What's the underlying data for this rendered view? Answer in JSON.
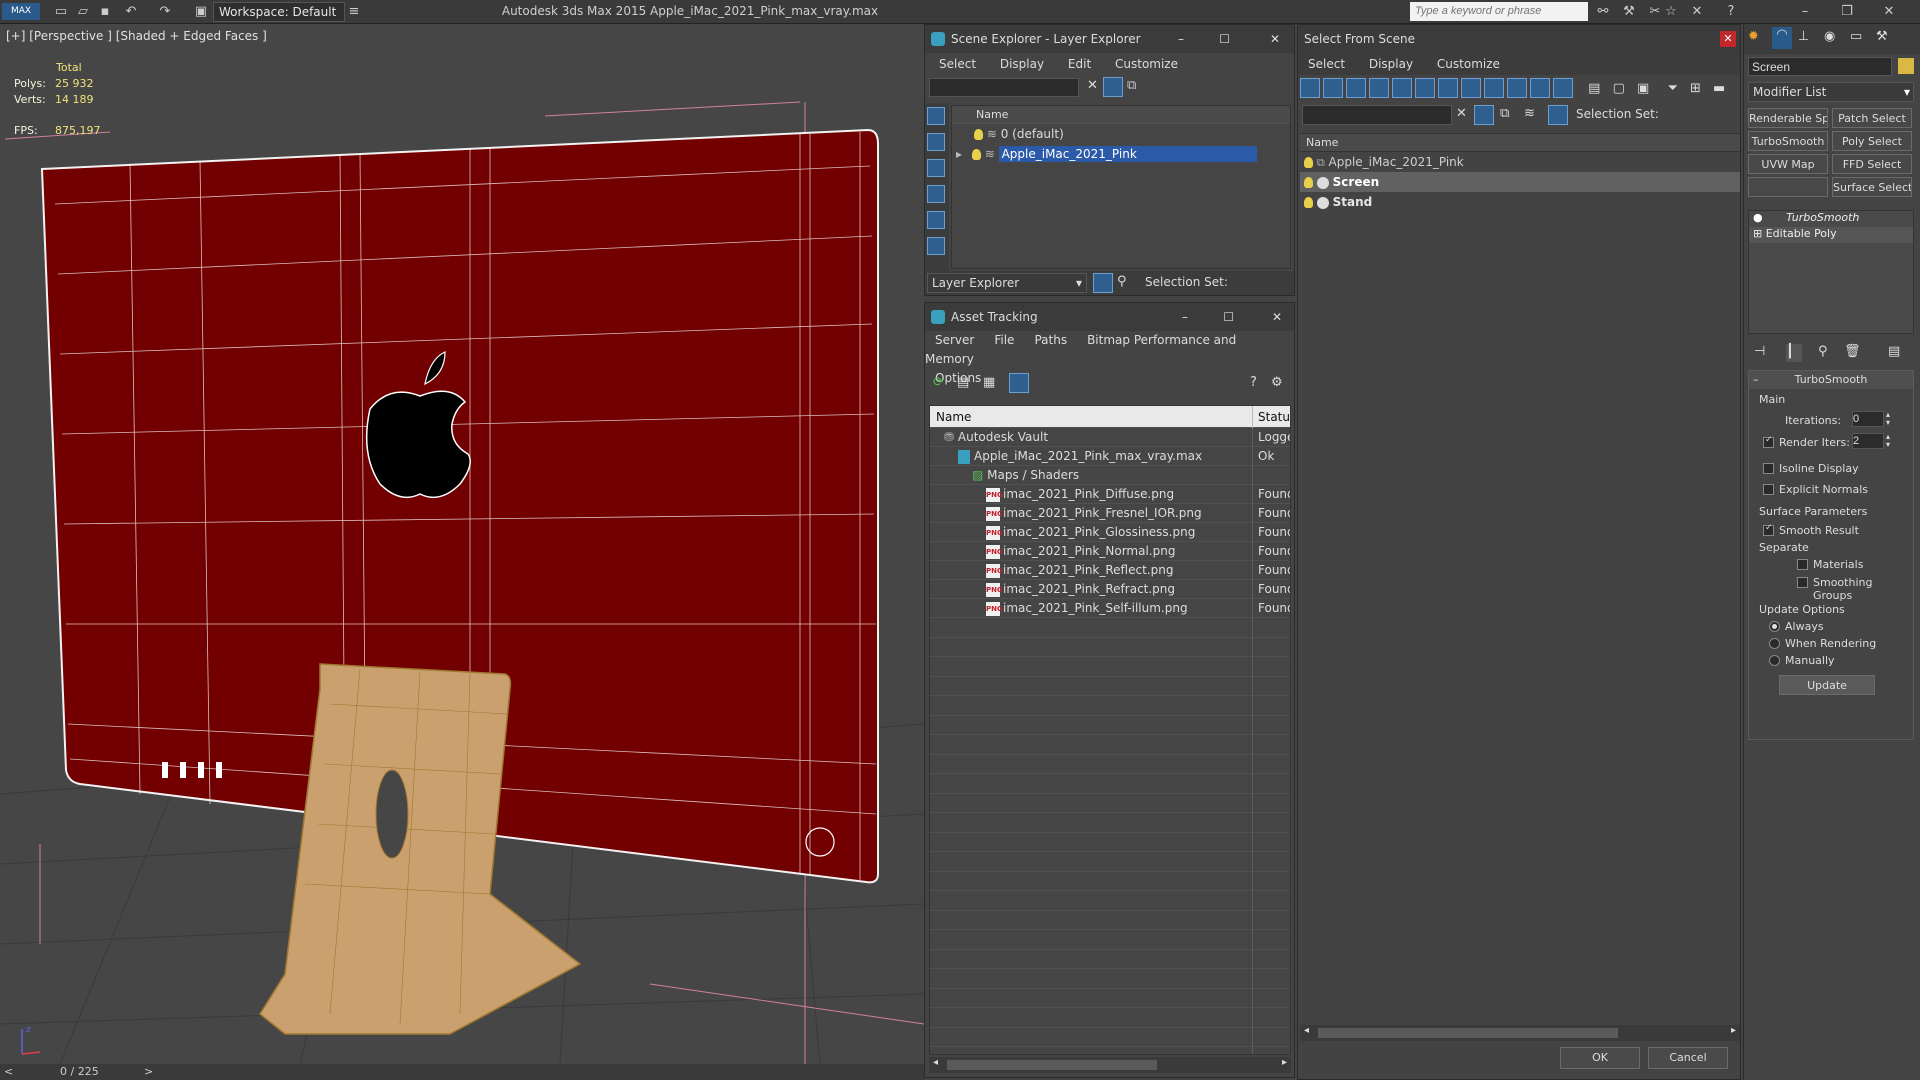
{
  "titlebar": {
    "app_title": "Autodesk 3ds Max  2015     Apple_iMac_2021_Pink_max_vray.max",
    "workspace": "Workspace: Default",
    "search_placeholder": "Type a keyword or phrase"
  },
  "viewport": {
    "label": "[+] [Perspective ] [Shaded + Edged Faces ]",
    "stats": {
      "total_label": "Total",
      "polys_label": "Polys:",
      "polys": "25 932",
      "verts_label": "Verts:",
      "verts": "14 189",
      "fps_label": "FPS:",
      "fps": "875,197"
    },
    "frame_counter": "0 / 225"
  },
  "scene_explorer": {
    "title": "Scene Explorer - Layer Explorer",
    "menu": [
      "Select",
      "Display",
      "Edit",
      "Customize"
    ],
    "column_name": "Name",
    "layers": [
      {
        "name": "0 (default)",
        "selected": false
      },
      {
        "name": "Apple_iMac_2021_Pink",
        "selected": true
      }
    ],
    "footer_dropdown": "Layer Explorer",
    "footer_selection_set": "Selection Set:"
  },
  "asset_tracking": {
    "title": "Asset Tracking",
    "menu": [
      "Server",
      "File",
      "Paths",
      "Bitmap Performance and Memory",
      "Options"
    ],
    "col_name": "Name",
    "col_status": "Status",
    "rows": [
      {
        "name": "Autodesk Vault",
        "status": "Logged",
        "indent": 1,
        "icon": "vault"
      },
      {
        "name": "Apple_iMac_2021_Pink_max_vray.max",
        "status": "Ok",
        "indent": 2,
        "icon": "max"
      },
      {
        "name": "Maps / Shaders",
        "status": "",
        "indent": 3,
        "icon": "maps"
      },
      {
        "name": "imac_2021_Pink_Diffuse.png",
        "status": "Found",
        "indent": 4,
        "icon": "png"
      },
      {
        "name": "imac_2021_Pink_Fresnel_IOR.png",
        "status": "Found",
        "indent": 4,
        "icon": "png"
      },
      {
        "name": "imac_2021_Pink_Glossiness.png",
        "status": "Found",
        "indent": 4,
        "icon": "png"
      },
      {
        "name": "imac_2021_Pink_Normal.png",
        "status": "Found",
        "indent": 4,
        "icon": "png"
      },
      {
        "name": "imac_2021_Pink_Reflect.png",
        "status": "Found",
        "indent": 4,
        "icon": "png"
      },
      {
        "name": "imac_2021_Pink_Refract.png",
        "status": "Found",
        "indent": 4,
        "icon": "png"
      },
      {
        "name": "imac_2021_Pink_Self-illum.png",
        "status": "Found",
        "indent": 4,
        "icon": "png"
      }
    ],
    "png_badge": "PNG"
  },
  "select_from_scene": {
    "title": "Select From Scene",
    "menu": [
      "Select",
      "Display",
      "Customize"
    ],
    "selection_set": "Selection Set:",
    "column_name": "Name",
    "objects": [
      {
        "name": "Apple_iMac_2021_Pink",
        "selected": false,
        "bold": false
      },
      {
        "name": "Screen",
        "selected": true,
        "bold": true
      },
      {
        "name": "Stand",
        "selected": false,
        "bold": true
      }
    ],
    "ok": "OK",
    "cancel": "Cancel"
  },
  "command_panel": {
    "object_name": "Screen",
    "modifier_list": "Modifier List",
    "buttons": [
      "Renderable Spline",
      "Patch Select",
      "TurboSmooth",
      "Poly Select",
      "UVW Map",
      "FFD Select",
      "",
      "Surface Select"
    ],
    "stack": [
      "TurboSmooth",
      "Editable Poly"
    ],
    "rollout_title": "TurboSmooth",
    "main_label": "Main",
    "iterations_label": "Iterations:",
    "iterations": "0",
    "render_iters_label": "Render Iters:",
    "render_iters": "2",
    "isoline": "Isoline Display",
    "explicit_normals": "Explicit Normals",
    "surface_params": "Surface Parameters",
    "smooth_result": "Smooth Result",
    "separate": "Separate",
    "materials": "Materials",
    "smoothing_groups": "Smoothing Groups",
    "update_options": "Update Options",
    "always": "Always",
    "when_rendering": "When Rendering",
    "manually": "Manually",
    "update_btn": "Update"
  }
}
